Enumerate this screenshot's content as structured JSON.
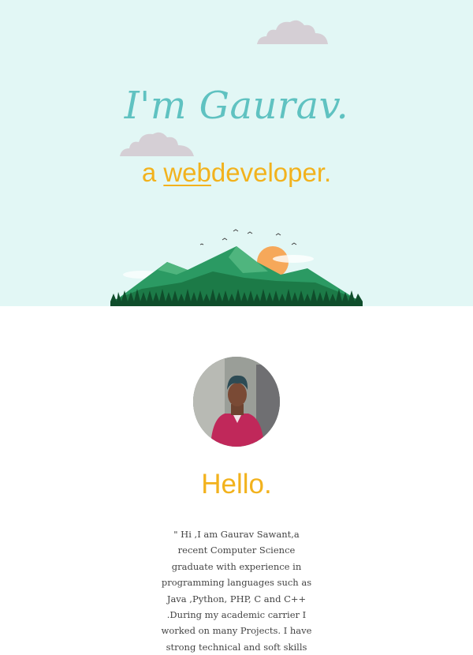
{
  "hero": {
    "name": "I'm Gaurav.",
    "role_prefix": "a ",
    "role_highlight": "web",
    "role_suffix": "developer.",
    "background": "#e2f7f5",
    "name_color": "#5fc2c1",
    "accent": "#f2b21d"
  },
  "about": {
    "avatar_alt": "profile-photo",
    "heading": "Hello.",
    "bio": "\" Hi ,I am Gaurav Sawant,a recent Computer Science graduate with experience in programming languages such as Java ,Python, PHP, C and C++ .During my academic carrier I worked on many Projects. I have strong technical and soft skills"
  }
}
